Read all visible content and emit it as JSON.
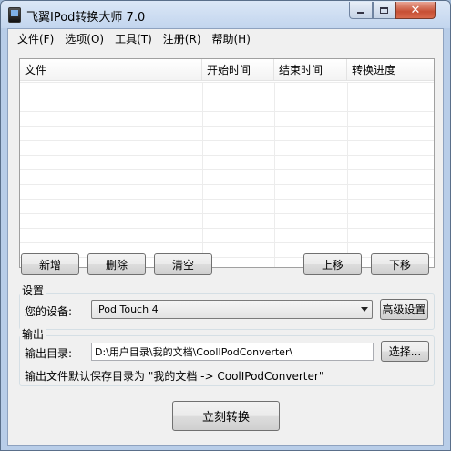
{
  "window": {
    "title": "飞翼IPod转换大师 7.0"
  },
  "menu": {
    "items": [
      "文件(F)",
      "选项(O)",
      "工具(T)",
      "注册(R)",
      "帮助(H)"
    ]
  },
  "file_list": {
    "columns": [
      "文件",
      "开始时间",
      "结束时间",
      "转换进度"
    ],
    "rows": []
  },
  "list_buttons": {
    "add": "新增",
    "delete": "删除",
    "clear": "清空",
    "move_up": "上移",
    "move_down": "下移"
  },
  "settings": {
    "group_title": "设置",
    "device_label": "您的设备:",
    "device_value": "iPod Touch 4",
    "advanced_button": "高级设置"
  },
  "output": {
    "group_title": "输出",
    "dir_label": "输出目录:",
    "dir_value": "D:\\用户目录\\我的文档\\CoolIPodConverter\\",
    "choose_button": "选择...",
    "note": "输出文件默认保存目录为 \"我的文档 -> CoolIPodConverter\""
  },
  "convert_button": "立刻转换"
}
